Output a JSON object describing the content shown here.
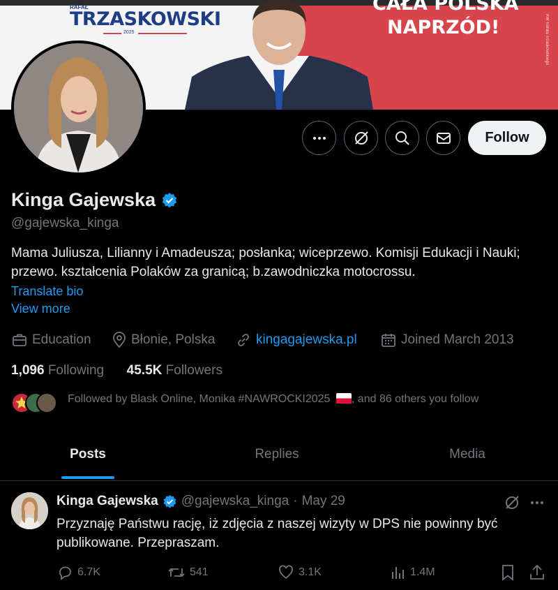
{
  "banner": {
    "name_small": "RAFAŁ",
    "name": "TRZASKOWSKI",
    "year": "2025",
    "slogan_line1": "CAŁA POLSKA",
    "slogan_line2": "NAPRZÓD!",
    "fine_print": "KW Rafała Trzaskowskiego"
  },
  "profile": {
    "display_name": "Kinga Gajewska",
    "handle": "@gajewska_kinga",
    "bio": "Mama Juliusza, Lilianny i Amadeusza; posłanka; wiceprzewo. Komisji Edukacji i Nauki; przewo. kształcenia Polaków za granicą; b.zawodniczka motocrossu.",
    "translate_label": "Translate bio",
    "view_more_label": "View more",
    "category": "Education",
    "location": "Błonie, Polska",
    "website": "kingagajewska.pl",
    "joined": "Joined March 2013",
    "following_count": "1,096",
    "following_label": "Following",
    "followers_count": "45.5K",
    "followers_label": "Followers",
    "followed_by_prefix": "Followed by Blask Online, Monika #NAWROCKI2025",
    "followed_by_suffix": ", and 86 others you follow"
  },
  "actions": {
    "more_icon": "more-icon",
    "grok_icon": "grok-icon",
    "search_icon": "search-icon",
    "message_icon": "message-icon",
    "follow_label": "Follow"
  },
  "tabs": [
    {
      "label": "Posts",
      "active": true
    },
    {
      "label": "Replies",
      "active": false
    },
    {
      "label": "Media",
      "active": false
    }
  ],
  "post": {
    "author": "Kinga Gajewska",
    "handle": "@gajewska_kinga",
    "separator": "·",
    "date": "May 29",
    "text": "Przyznaję Państwu rację, iż zdjęcia z naszej wizyty w DPS nie powinny być publikowane. Przepraszam.",
    "replies": "6.7K",
    "reposts": "541",
    "likes": "3.1K",
    "views": "1.4M"
  },
  "colors": {
    "accent": "#1d9bf0",
    "background": "#000000",
    "muted": "#71767b",
    "banner_red": "#d8444b",
    "banner_blue": "#1f3d83"
  }
}
